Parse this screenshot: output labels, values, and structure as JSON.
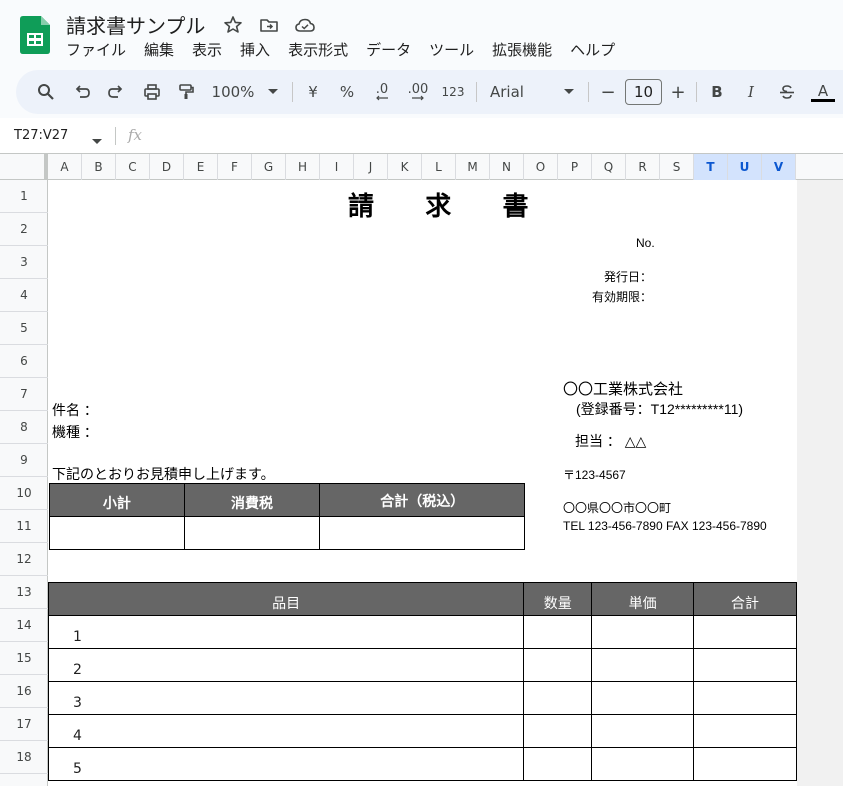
{
  "app": {
    "title": "請求書サンプル",
    "menu": [
      "ファイル",
      "編集",
      "表示",
      "挿入",
      "表示形式",
      "データ",
      "ツール",
      "拡張機能",
      "ヘルプ"
    ]
  },
  "toolbar": {
    "zoom": "100%",
    "currency": "¥",
    "percent": "%",
    "dec_decrease": ".0",
    "dec_increase": ".00",
    "format_123": "123",
    "font": "Arial",
    "font_size": "10",
    "minus": "−",
    "plus": "+",
    "bold": "B",
    "italic": "I",
    "text_color": "A"
  },
  "formula_bar": {
    "name_box": "T27:V27",
    "fx": "fx"
  },
  "columns": [
    "A",
    "B",
    "C",
    "D",
    "E",
    "F",
    "G",
    "H",
    "I",
    "J",
    "K",
    "L",
    "M",
    "N",
    "O",
    "P",
    "Q",
    "R",
    "S",
    "T",
    "U",
    "V"
  ],
  "selected_columns": [
    "T",
    "U",
    "V"
  ],
  "rows": [
    "1",
    "2",
    "3",
    "4",
    "5",
    "6",
    "7",
    "8",
    "9",
    "10",
    "11",
    "12",
    "13",
    "14",
    "15",
    "16",
    "17",
    "18"
  ],
  "invoice": {
    "title": "請 求 書",
    "no_label": "No.",
    "issue_date_label": "発行日：",
    "expiry_label": "有効期限：",
    "subject_label": "件名 ：",
    "model_label": "機種 ：",
    "intro": "下記のとおりお見積申し上げます。",
    "company": "〇〇工業株式会社",
    "registration": "(登録番号：T12*********11)",
    "contact": "担当 ： △△",
    "postal": "〒123-4567",
    "address": "〇〇県〇〇市〇〇町",
    "phone": "TEL 123-456-7890  FAX 123-456-7890",
    "summary_headers": [
      "小計",
      "消費税",
      "合計（税込）"
    ],
    "item_headers": [
      "品目",
      "数量",
      "単価",
      "合計"
    ],
    "item_numbers": [
      "1",
      "2",
      "3",
      "4",
      "5"
    ]
  },
  "colors": {
    "header_fill": "#666666",
    "selected_column": "#d3e3fd",
    "toolbar_bg": "#edf2fa"
  }
}
